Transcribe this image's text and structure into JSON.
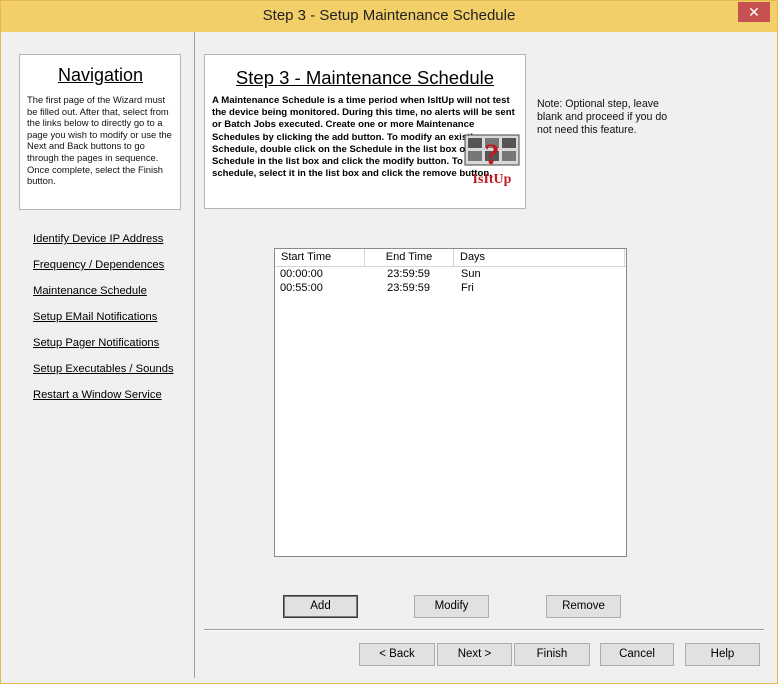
{
  "window": {
    "title": "Step 3 - Setup Maintenance Schedule",
    "close_glyph": "✕"
  },
  "navigation": {
    "title": "Navigation",
    "description": "The first page of the Wizard must be filled out. After that, select from the links below to directly go to a page you wish to modify or use the Next and Back buttons to go through the pages in sequence. Once complete, select the Finish button.",
    "links": [
      "Identify Device IP Address",
      "Frequency / Dependences",
      "Maintenance Schedule",
      "Setup EMail Notifications",
      "Setup Pager Notifications",
      "Setup Executables / Sounds",
      "Restart a Window Service"
    ]
  },
  "step": {
    "title": "Step 3 - Maintenance Schedule",
    "description": "A Maintenance Schedule is a time period when IsItUp will not test the device being monitored. During this time, no alerts will be sent or Batch Jobs executed.  Create one or more Maintenance Schedules by clicking the add button. To modify an existing Schedule, double click on the Schedule in the list box or select a Schedule in the  list box and click the modify button. To delete a schedule, select it in the list box and click the remove button.",
    "logo_text": "IsItUp",
    "logo_icon": "question-mark-icon"
  },
  "note": "Note: Optional step, leave blank and proceed if you do not need this feature.",
  "schedule_list": {
    "columns": [
      "Start Time",
      "End Time",
      "Days"
    ],
    "rows": [
      {
        "start": "00:00:00",
        "end": "23:59:59",
        "days": "Sun"
      },
      {
        "start": "00:55:00",
        "end": "23:59:59",
        "days": "Fri"
      }
    ]
  },
  "list_buttons": {
    "add": "Add",
    "modify": "Modify",
    "remove": "Remove"
  },
  "wizard_buttons": {
    "back": "< Back",
    "next": "Next >",
    "finish": "Finish",
    "cancel": "Cancel",
    "help": "Help"
  },
  "colors": {
    "titlebar": "#f3cf6a",
    "close_button": "#c75050",
    "logo_red": "#c0181f"
  }
}
